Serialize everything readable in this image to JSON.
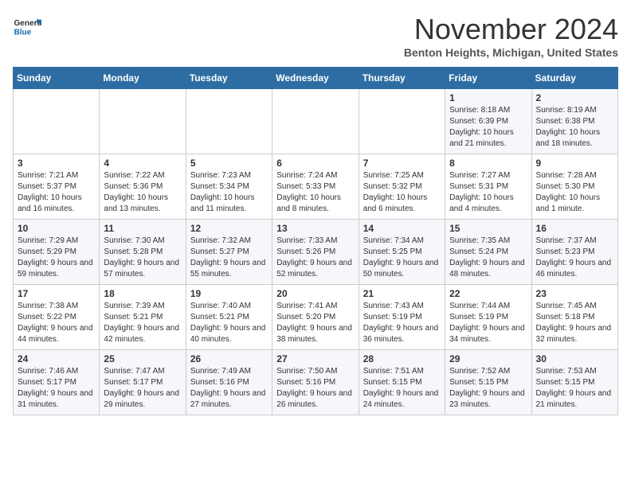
{
  "header": {
    "logo_line1": "General",
    "logo_line2": "Blue",
    "month": "November 2024",
    "location": "Benton Heights, Michigan, United States"
  },
  "days_of_week": [
    "Sunday",
    "Monday",
    "Tuesday",
    "Wednesday",
    "Thursday",
    "Friday",
    "Saturday"
  ],
  "weeks": [
    [
      {
        "day": "",
        "info": ""
      },
      {
        "day": "",
        "info": ""
      },
      {
        "day": "",
        "info": ""
      },
      {
        "day": "",
        "info": ""
      },
      {
        "day": "",
        "info": ""
      },
      {
        "day": "1",
        "info": "Sunrise: 8:18 AM\nSunset: 6:39 PM\nDaylight: 10 hours and 21 minutes."
      },
      {
        "day": "2",
        "info": "Sunrise: 8:19 AM\nSunset: 6:38 PM\nDaylight: 10 hours and 18 minutes."
      }
    ],
    [
      {
        "day": "3",
        "info": "Sunrise: 7:21 AM\nSunset: 5:37 PM\nDaylight: 10 hours and 16 minutes."
      },
      {
        "day": "4",
        "info": "Sunrise: 7:22 AM\nSunset: 5:36 PM\nDaylight: 10 hours and 13 minutes."
      },
      {
        "day": "5",
        "info": "Sunrise: 7:23 AM\nSunset: 5:34 PM\nDaylight: 10 hours and 11 minutes."
      },
      {
        "day": "6",
        "info": "Sunrise: 7:24 AM\nSunset: 5:33 PM\nDaylight: 10 hours and 8 minutes."
      },
      {
        "day": "7",
        "info": "Sunrise: 7:25 AM\nSunset: 5:32 PM\nDaylight: 10 hours and 6 minutes."
      },
      {
        "day": "8",
        "info": "Sunrise: 7:27 AM\nSunset: 5:31 PM\nDaylight: 10 hours and 4 minutes."
      },
      {
        "day": "9",
        "info": "Sunrise: 7:28 AM\nSunset: 5:30 PM\nDaylight: 10 hours and 1 minute."
      }
    ],
    [
      {
        "day": "10",
        "info": "Sunrise: 7:29 AM\nSunset: 5:29 PM\nDaylight: 9 hours and 59 minutes."
      },
      {
        "day": "11",
        "info": "Sunrise: 7:30 AM\nSunset: 5:28 PM\nDaylight: 9 hours and 57 minutes."
      },
      {
        "day": "12",
        "info": "Sunrise: 7:32 AM\nSunset: 5:27 PM\nDaylight: 9 hours and 55 minutes."
      },
      {
        "day": "13",
        "info": "Sunrise: 7:33 AM\nSunset: 5:26 PM\nDaylight: 9 hours and 52 minutes."
      },
      {
        "day": "14",
        "info": "Sunrise: 7:34 AM\nSunset: 5:25 PM\nDaylight: 9 hours and 50 minutes."
      },
      {
        "day": "15",
        "info": "Sunrise: 7:35 AM\nSunset: 5:24 PM\nDaylight: 9 hours and 48 minutes."
      },
      {
        "day": "16",
        "info": "Sunrise: 7:37 AM\nSunset: 5:23 PM\nDaylight: 9 hours and 46 minutes."
      }
    ],
    [
      {
        "day": "17",
        "info": "Sunrise: 7:38 AM\nSunset: 5:22 PM\nDaylight: 9 hours and 44 minutes."
      },
      {
        "day": "18",
        "info": "Sunrise: 7:39 AM\nSunset: 5:21 PM\nDaylight: 9 hours and 42 minutes."
      },
      {
        "day": "19",
        "info": "Sunrise: 7:40 AM\nSunset: 5:21 PM\nDaylight: 9 hours and 40 minutes."
      },
      {
        "day": "20",
        "info": "Sunrise: 7:41 AM\nSunset: 5:20 PM\nDaylight: 9 hours and 38 minutes."
      },
      {
        "day": "21",
        "info": "Sunrise: 7:43 AM\nSunset: 5:19 PM\nDaylight: 9 hours and 36 minutes."
      },
      {
        "day": "22",
        "info": "Sunrise: 7:44 AM\nSunset: 5:19 PM\nDaylight: 9 hours and 34 minutes."
      },
      {
        "day": "23",
        "info": "Sunrise: 7:45 AM\nSunset: 5:18 PM\nDaylight: 9 hours and 32 minutes."
      }
    ],
    [
      {
        "day": "24",
        "info": "Sunrise: 7:46 AM\nSunset: 5:17 PM\nDaylight: 9 hours and 31 minutes."
      },
      {
        "day": "25",
        "info": "Sunrise: 7:47 AM\nSunset: 5:17 PM\nDaylight: 9 hours and 29 minutes."
      },
      {
        "day": "26",
        "info": "Sunrise: 7:49 AM\nSunset: 5:16 PM\nDaylight: 9 hours and 27 minutes."
      },
      {
        "day": "27",
        "info": "Sunrise: 7:50 AM\nSunset: 5:16 PM\nDaylight: 9 hours and 26 minutes."
      },
      {
        "day": "28",
        "info": "Sunrise: 7:51 AM\nSunset: 5:15 PM\nDaylight: 9 hours and 24 minutes."
      },
      {
        "day": "29",
        "info": "Sunrise: 7:52 AM\nSunset: 5:15 PM\nDaylight: 9 hours and 23 minutes."
      },
      {
        "day": "30",
        "info": "Sunrise: 7:53 AM\nSunset: 5:15 PM\nDaylight: 9 hours and 21 minutes."
      }
    ]
  ]
}
